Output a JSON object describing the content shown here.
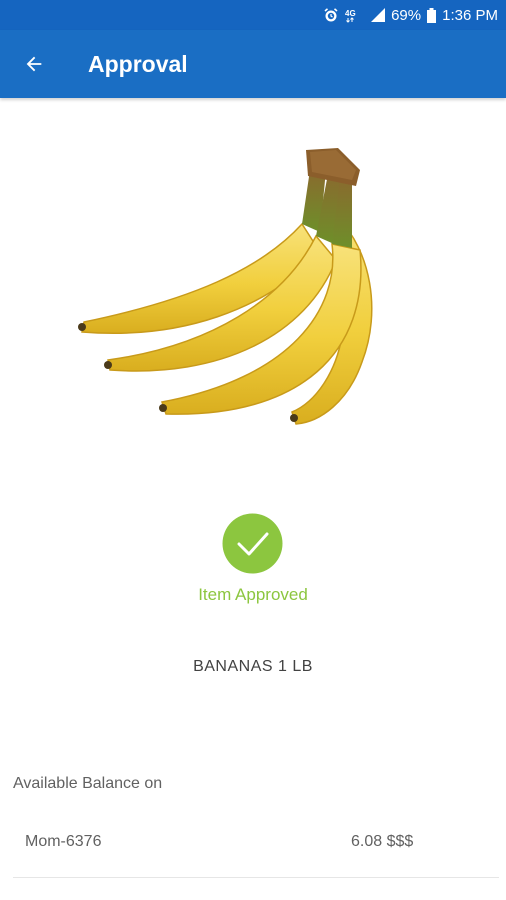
{
  "status_bar": {
    "battery": "69%",
    "time": "1:36 PM",
    "icons": [
      "alarm-icon",
      "lte-icon",
      "signal-icon",
      "battery-icon"
    ]
  },
  "app_bar": {
    "title": "Approval",
    "back_icon": "arrow-back-icon",
    "background_color": "#1a6ec4"
  },
  "product": {
    "image": "bananas-image",
    "name": "BANANAS 1 LB"
  },
  "approval": {
    "icon": "check-circle-icon",
    "status_text": "Item Approved",
    "color": "#8cc63f"
  },
  "balance": {
    "heading": "Available Balance on",
    "account_name": "Mom-6376",
    "amount": "6.08 $$$"
  }
}
